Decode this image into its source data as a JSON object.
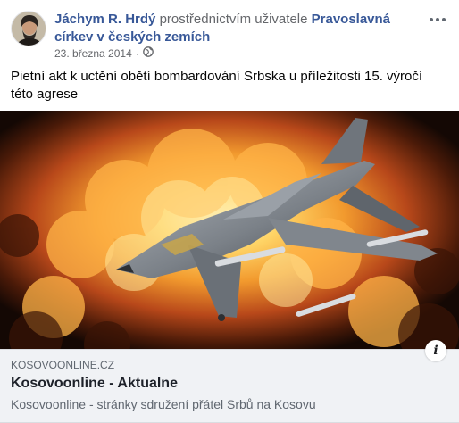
{
  "post": {
    "author_name": "Jáchym R. Hrdý",
    "via_text": "prostřednictvím uživatele",
    "page_name": "Pravoslavná církev v českých zemích",
    "date": "23. března 2014",
    "date_separator": "·",
    "privacy_icon": "globe-icon",
    "more_icon": "more-options-icon",
    "text": "Pietní akt k uctění obětí bombardování Srbska u příležitosti 15. výročí této agrese"
  },
  "link_preview": {
    "domain": "KOSOVOONLINE.CZ",
    "title": "Kosovoonline - Aktualne",
    "description": "Kosovoonline - stránky sdružení přátel Srbů na Kosovu",
    "info_label": "i",
    "image_subject": "fighter-jet-explosion-image"
  },
  "colors": {
    "link_blue": "#385898",
    "meta_gray": "#65676b",
    "caption_bg": "#f0f2f5"
  }
}
